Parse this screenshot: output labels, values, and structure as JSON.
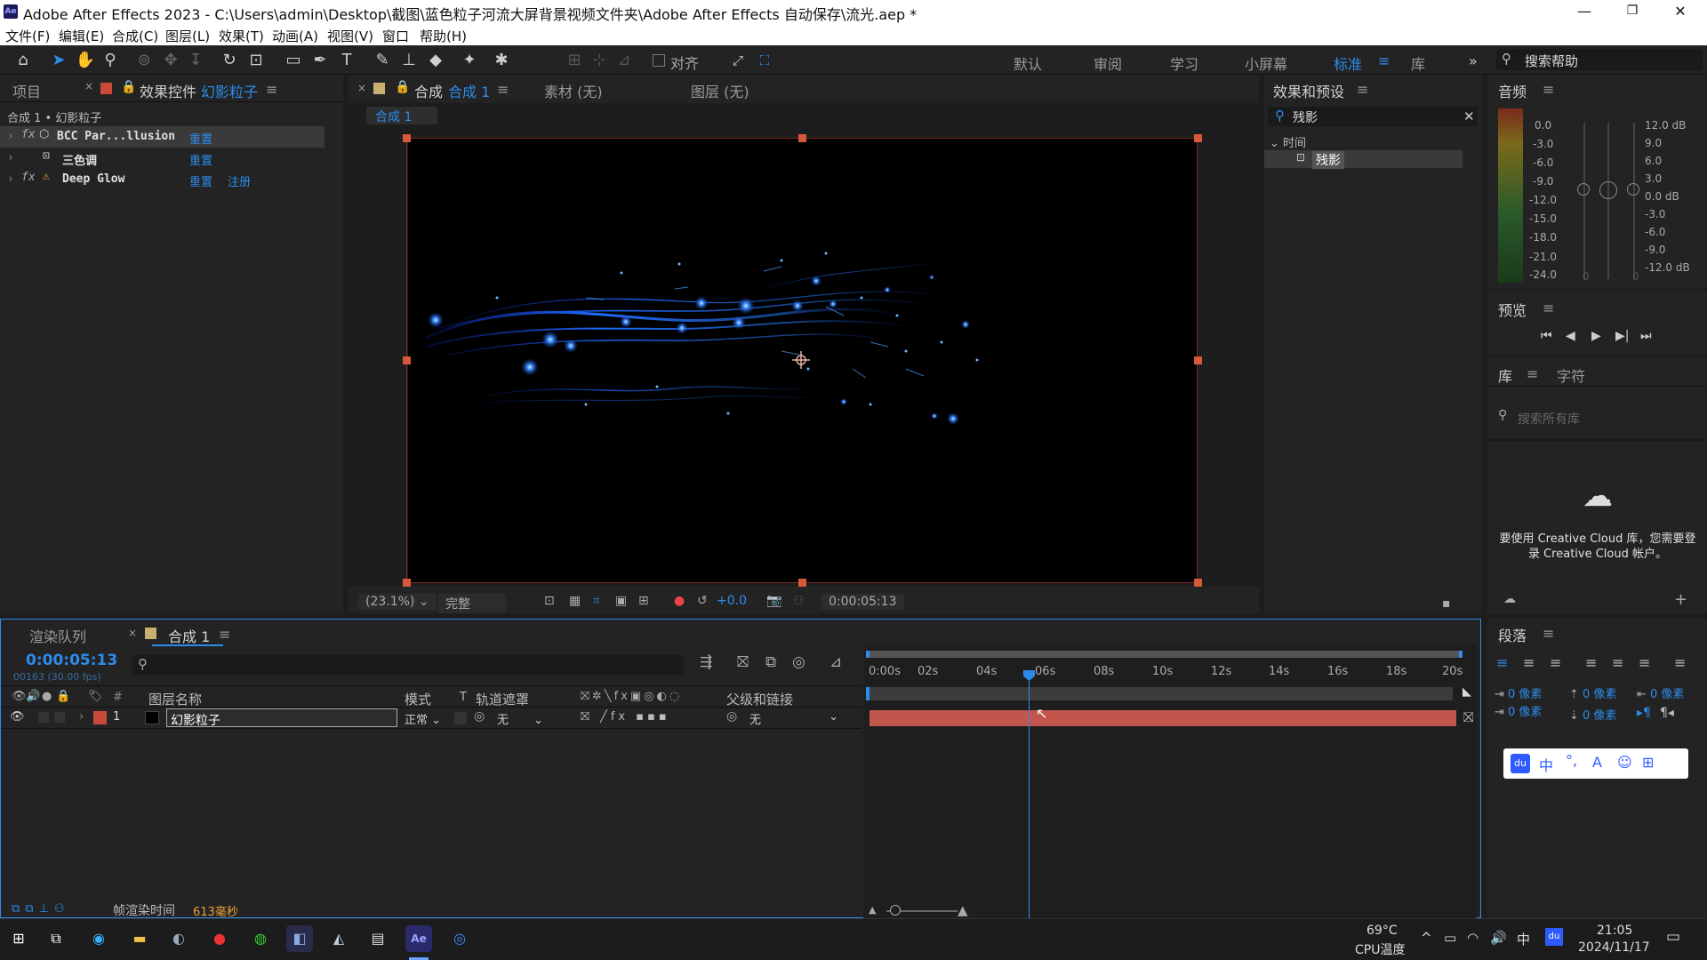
{
  "window": {
    "title": "Adobe After Effects 2023 - C:\\Users\\admin\\Desktop\\截图\\蓝色粒子河流大屏背景视频文件夹\\Adobe After Effects 自动保存\\流光.aep *",
    "minimize": "—",
    "maximize": "❐",
    "close": "✕",
    "logo": "Ae"
  },
  "menu": [
    "文件(F)",
    "编辑(E)",
    "合成(C)",
    "图层(L)",
    "效果(T)",
    "动画(A)",
    "视图(V)",
    "窗口",
    "帮助(H)"
  ],
  "toolbar": {
    "snap_label": "对齐",
    "workspaces": [
      "默认",
      "审阅",
      "学习",
      "小屏幕",
      "标准",
      "库"
    ],
    "active_workspace": "标准",
    "more": "»",
    "search_help": "搜索帮助"
  },
  "project_panel": {
    "tab": "项目",
    "effects_tab_prefix": "效果控件",
    "effects_tab_layer": "幻影粒子",
    "breadcrumb": "合成 1 • 幻影粒子"
  },
  "effects": [
    {
      "name": "BCC Par...llusion",
      "actions": [
        "重置"
      ]
    },
    {
      "name": "三色调",
      "actions": [
        "重置"
      ]
    },
    {
      "name": "Deep Glow",
      "actions": [
        "重置",
        "注册"
      ]
    }
  ],
  "comp_panel": {
    "tab_prefix": "合成",
    "tab_comp": "合成 1",
    "footage_tab": "素材 (无)",
    "layer_tab": "图层 (无)",
    "comp_button": "合成 1"
  },
  "viewer_bar": {
    "zoom": "(23.1%)",
    "resolution": "完整",
    "exposure": "+0.0",
    "timecode": "0:00:05:13"
  },
  "effects_presets": {
    "title": "效果和预设",
    "search_value": "残影",
    "category": "时间",
    "item": "残影"
  },
  "audio": {
    "title": "音频",
    "left_scale": [
      "0.0",
      "-3.0",
      "-6.0",
      "-9.0",
      "-12.0",
      "-15.0",
      "-18.0",
      "-21.0",
      "-24.0"
    ],
    "right_scale": [
      "12.0 dB",
      "9.0",
      "6.0",
      "3.0",
      "0.0 dB",
      "-3.0",
      "-6.0",
      "-9.0",
      "-12.0 dB"
    ],
    "zero_left": "0",
    "zero_right": "0"
  },
  "preview": {
    "title": "预览"
  },
  "library": {
    "tab": "库",
    "tab2": "字符",
    "search_placeholder": "搜索所有库",
    "message": "要使用 Creative Cloud 库，您需要登录 Creative Cloud 帐户。"
  },
  "paragraph": {
    "title": "段落",
    "indent_values": [
      "0 像素",
      "0 像素",
      "0 像素",
      "0 像素",
      "0 像素"
    ]
  },
  "ime": {
    "items": [
      "du",
      "中",
      "°,",
      "A",
      "☺",
      "⊞"
    ]
  },
  "timeline": {
    "render_tab": "渲染队列",
    "comp_tab": "合成 1",
    "timecode": "0:00:05:13",
    "frames": "00163 (30.00 fps)",
    "headers": {
      "num": "#",
      "name": "图层名称",
      "mode": "模式",
      "t": "T",
      "track": "轨道遮罩",
      "parent": "父级和链接"
    },
    "layer": {
      "index": "1",
      "name": "幻影粒子",
      "mode": "正常",
      "track": "无",
      "parent": "无"
    },
    "ticks": [
      "0:00s",
      "02s",
      "04s",
      "06s",
      "08s",
      "10s",
      "12s",
      "14s",
      "16s",
      "18s",
      "20s"
    ],
    "current_time_fraction": 0.2717,
    "render_time_label": "帧渲染时间",
    "render_time_value": "613毫秒"
  },
  "taskbar": {
    "cpu_temp": "69°C",
    "cpu_label": "CPU温度",
    "ime_lang": "中",
    "time": "21:05",
    "date": "2024/11/17"
  },
  "colors": {
    "accent": "#2d8ceb",
    "layer_bar": "#c2564c",
    "handle": "#d65a3a",
    "label_red": "#c94a3a"
  }
}
